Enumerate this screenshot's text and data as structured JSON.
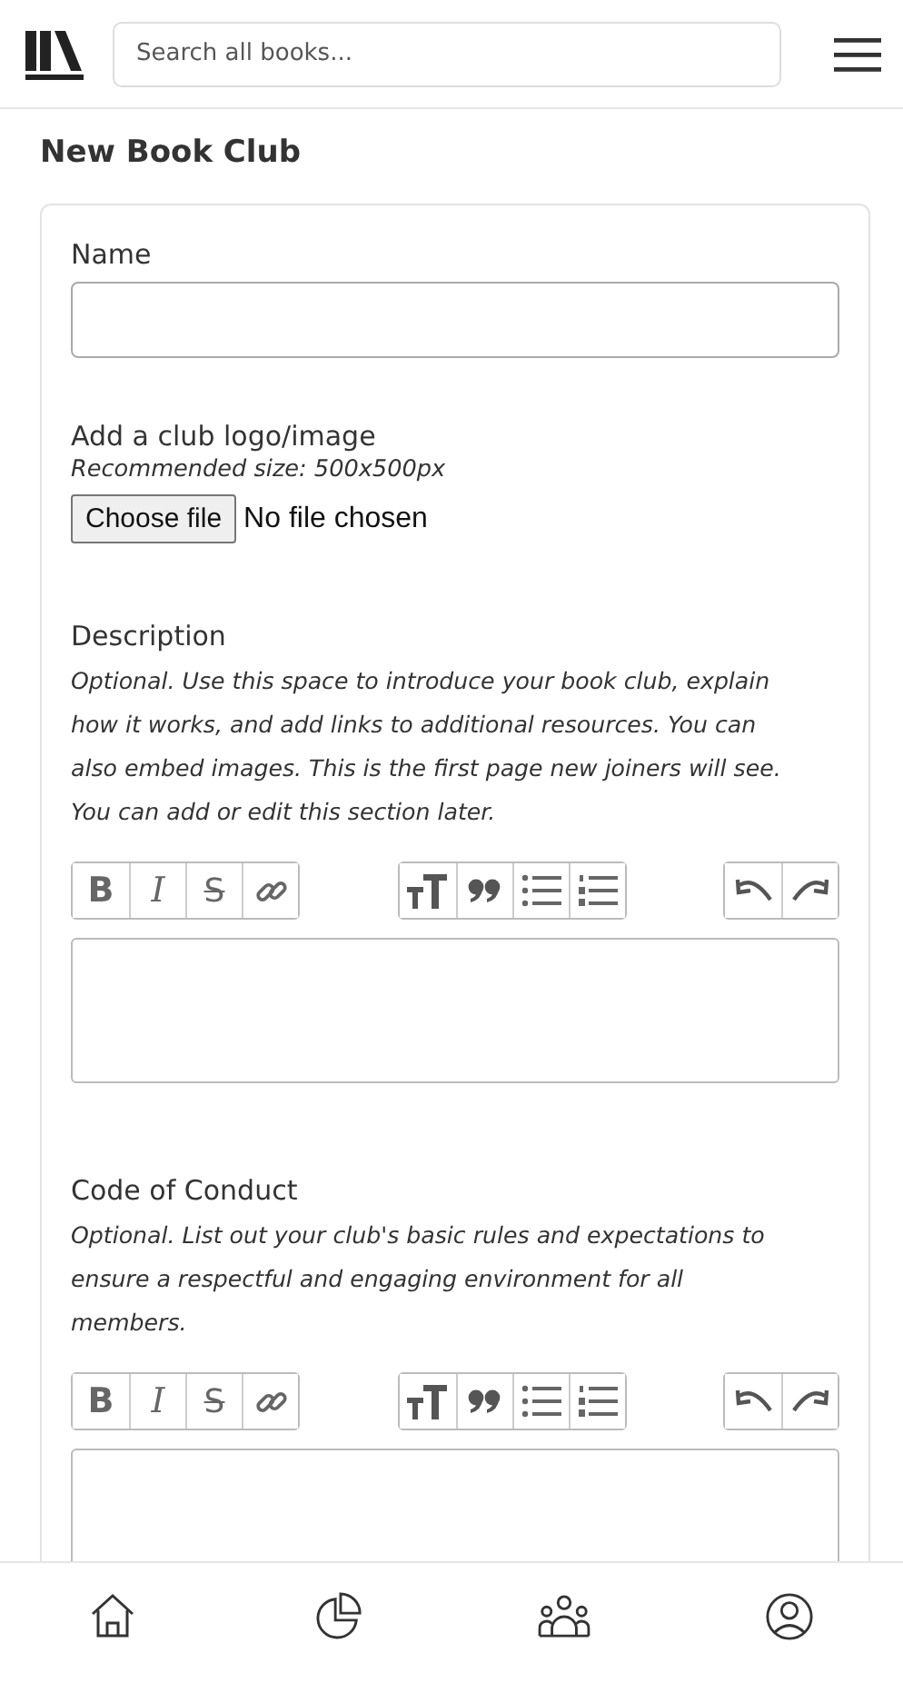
{
  "header": {
    "search": {
      "placeholder": "Search all books..."
    }
  },
  "page_title": "New Book Club",
  "form": {
    "name": {
      "label": "Name"
    },
    "logo": {
      "label": "Add a club logo/image",
      "hint": "Recommended size: 500x500px",
      "button": "Choose file",
      "status": "No file chosen"
    },
    "editors": [
      {
        "label": "Description",
        "hint": "Optional. Use this space to introduce your book club, explain how it works, and add links to additional resources. You can also embed images. This is the first page new joiners will see. You can add or edit this section later.",
        "toolbar": [
          {
            "group": [
              {
                "kind": "bold",
                "label": "B"
              },
              {
                "kind": "italic",
                "label": "I"
              },
              {
                "kind": "strike",
                "label": "S"
              },
              {
                "kind": "link"
              }
            ]
          },
          {
            "group": [
              {
                "kind": "heading"
              },
              {
                "kind": "quote"
              },
              {
                "kind": "bullets"
              },
              {
                "kind": "numbers"
              }
            ]
          },
          {
            "group": [
              {
                "kind": "undo"
              },
              {
                "kind": "redo"
              }
            ]
          }
        ]
      },
      {
        "label": "Code of Conduct",
        "hint": "Optional. List out your club's basic rules and expectations to ensure a respectful and engaging environment for all members.",
        "toolbar": [
          {
            "group": [
              {
                "kind": "bold",
                "label": "B"
              },
              {
                "kind": "italic",
                "label": "I"
              },
              {
                "kind": "strike",
                "label": "S"
              },
              {
                "kind": "link"
              }
            ]
          },
          {
            "group": [
              {
                "kind": "heading"
              },
              {
                "kind": "quote"
              },
              {
                "kind": "bullets"
              },
              {
                "kind": "numbers"
              }
            ]
          },
          {
            "group": [
              {
                "kind": "undo"
              },
              {
                "kind": "redo"
              }
            ]
          }
        ]
      }
    ]
  },
  "bottom_nav": [
    {
      "kind": "home"
    },
    {
      "kind": "stats"
    },
    {
      "kind": "clubs"
    },
    {
      "kind": "profile"
    }
  ]
}
